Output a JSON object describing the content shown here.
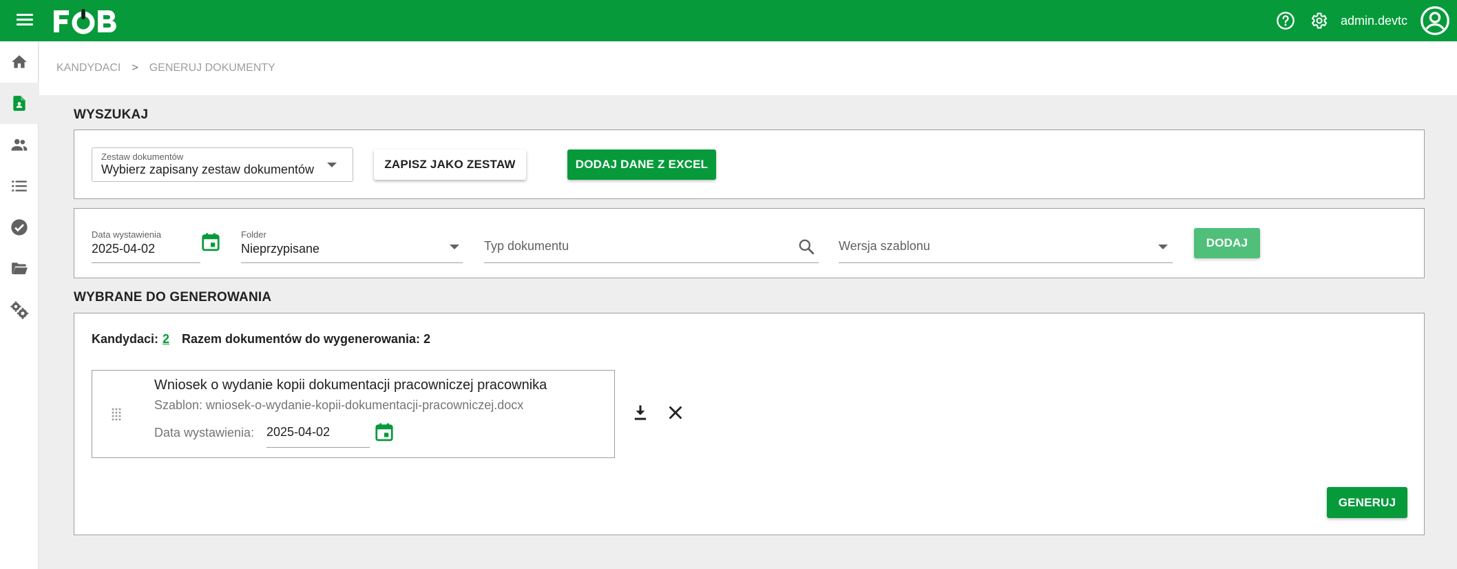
{
  "header": {
    "logo_text": "FOB",
    "username": "admin.devtc",
    "icons": [
      "menu-icon",
      "help-icon",
      "gear-icon",
      "account-circle-icon"
    ],
    "bar_color": "#069a3b"
  },
  "sidebar": {
    "items": [
      {
        "name": "home",
        "icon": "home-icon",
        "active": false
      },
      {
        "name": "documents",
        "icon": "document-person-icon",
        "active": true
      },
      {
        "name": "people",
        "icon": "people-icon",
        "active": false
      },
      {
        "name": "list",
        "icon": "list-icon",
        "active": false
      },
      {
        "name": "check",
        "icon": "check-circle-icon",
        "active": false
      },
      {
        "name": "folder",
        "icon": "folder-open-icon",
        "active": false
      },
      {
        "name": "settings",
        "icon": "gears-icon",
        "active": false
      }
    ]
  },
  "breadcrumb": {
    "items": [
      "KANDYDACI",
      "GENERUJ DOKUMENTY"
    ],
    "separator": ">"
  },
  "search": {
    "title": "WYSZUKAJ",
    "document_set": {
      "label": "Zestaw dokumentów",
      "value": "Wybierz zapisany zestaw dokumentów"
    },
    "save_as_set_button": "ZAPISZ JAKO ZESTAW",
    "add_excel_button": "DODAJ DANE Z EXCEL"
  },
  "filters": {
    "issue_date": {
      "label": "Data wystawienia",
      "value": "2025-04-02"
    },
    "folder": {
      "label": "Folder",
      "value": "Nieprzypisane"
    },
    "document_type": {
      "placeholder": "Typ dokumentu"
    },
    "template_version": {
      "placeholder": "Wersja szablonu"
    },
    "add_button": "DODAJ"
  },
  "selected": {
    "title": "WYBRANE DO GENEROWANIA",
    "candidates_label": "Kandydaci:",
    "candidates_count": "2",
    "total_label": "Razem dokumentów do wygenerowania: 2",
    "documents": [
      {
        "title": "Wniosek o wydanie kopii dokumentacji pracowniczej pracownika",
        "template": "Szablon: wniosek-o-wydanie-kopii-dokumentacji-pracowniczej.docx",
        "date_label": "Data wystawienia:",
        "date_value": "2025-04-02"
      }
    ],
    "generate_button": "GENERUJ"
  },
  "colors": {
    "accent": "#069a3b",
    "accent_light": "#4fbf79",
    "background": "#eeeeee"
  }
}
